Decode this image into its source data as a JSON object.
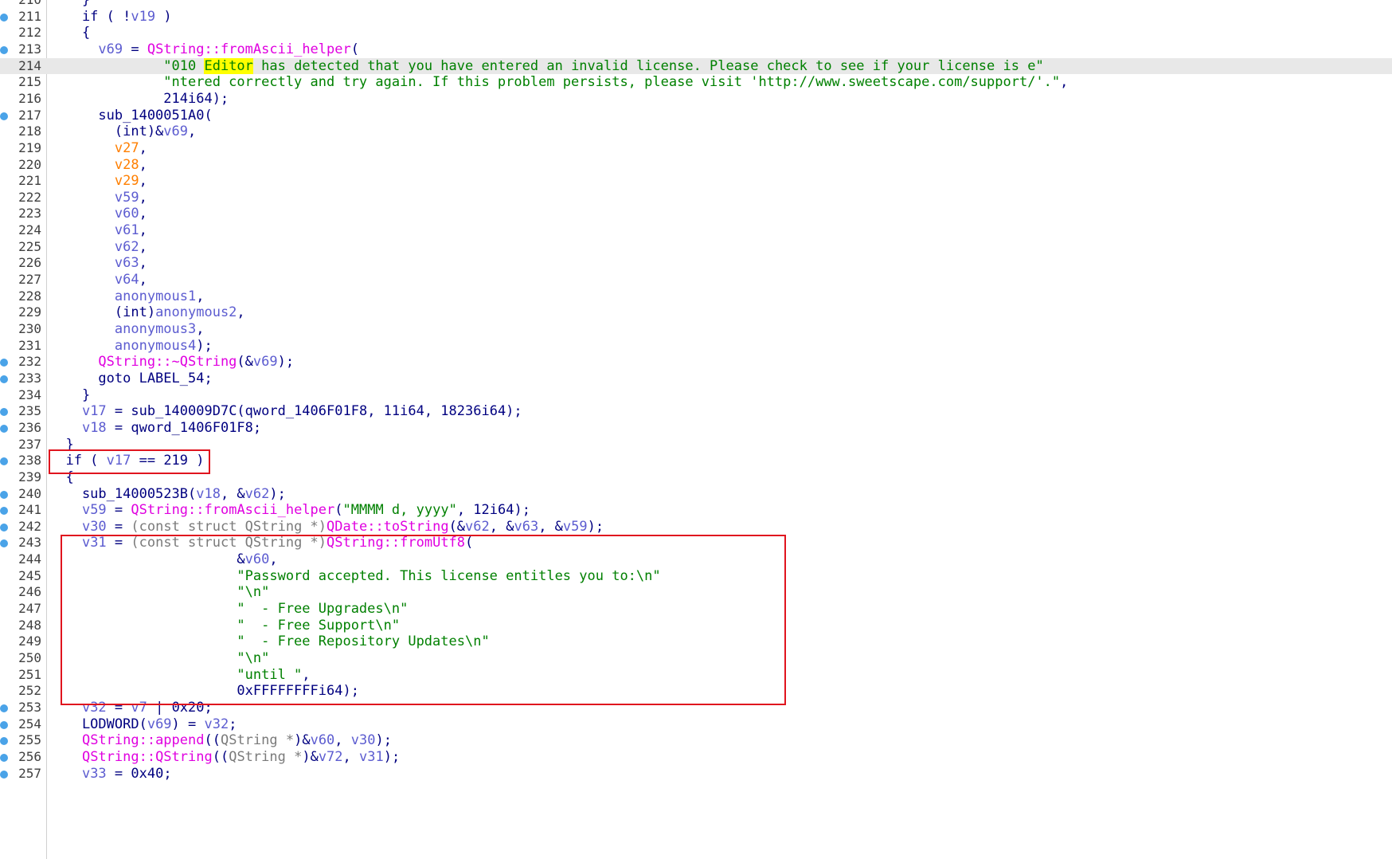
{
  "lines": [
    {
      "n": "210",
      "dot": false,
      "segs": [
        [
          "p",
          "    }"
        ]
      ]
    },
    {
      "n": "211",
      "dot": true,
      "segs": [
        [
          "p",
          "    if ( !"
        ],
        [
          "var",
          "v19"
        ],
        [
          "p",
          " )"
        ]
      ]
    },
    {
      "n": "212",
      "dot": false,
      "segs": [
        [
          "p",
          "    {"
        ]
      ]
    },
    {
      "n": "213",
      "dot": true,
      "segs": [
        [
          "p",
          "      "
        ],
        [
          "var",
          "v69"
        ],
        [
          "p",
          " = "
        ],
        [
          "fn",
          "QString::fromAscii_helper"
        ],
        [
          "p",
          "("
        ]
      ]
    },
    {
      "n": "214",
      "dot": false,
      "current": true,
      "segs": [
        [
          "p",
          "              "
        ],
        [
          "str",
          "\"010 "
        ],
        [
          "hl",
          "Editor"
        ],
        [
          "str",
          " has detected that you have entered an invalid license. Please check to see if your license is e\""
        ]
      ]
    },
    {
      "n": "215",
      "dot": false,
      "segs": [
        [
          "p",
          "              "
        ],
        [
          "str",
          "\"ntered correctly and try again. If this problem persists, please visit 'http://www.sweetscape.com/support/'.\""
        ],
        [
          "p",
          ","
        ]
      ]
    },
    {
      "n": "216",
      "dot": false,
      "segs": [
        [
          "p",
          "              214i64);"
        ]
      ]
    },
    {
      "n": "217",
      "dot": true,
      "segs": [
        [
          "p",
          "      sub_1400051A0("
        ]
      ]
    },
    {
      "n": "218",
      "dot": false,
      "segs": [
        [
          "p",
          "        (int)&"
        ],
        [
          "var",
          "v69"
        ],
        [
          "p",
          ","
        ]
      ]
    },
    {
      "n": "219",
      "dot": false,
      "segs": [
        [
          "p",
          "        "
        ],
        [
          "varo",
          "v27"
        ],
        [
          "p",
          ","
        ]
      ]
    },
    {
      "n": "220",
      "dot": false,
      "segs": [
        [
          "p",
          "        "
        ],
        [
          "varo",
          "v28"
        ],
        [
          "p",
          ","
        ]
      ]
    },
    {
      "n": "221",
      "dot": false,
      "segs": [
        [
          "p",
          "        "
        ],
        [
          "varo",
          "v29"
        ],
        [
          "p",
          ","
        ]
      ]
    },
    {
      "n": "222",
      "dot": false,
      "segs": [
        [
          "p",
          "        "
        ],
        [
          "var",
          "v59"
        ],
        [
          "p",
          ","
        ]
      ]
    },
    {
      "n": "223",
      "dot": false,
      "segs": [
        [
          "p",
          "        "
        ],
        [
          "var",
          "v60"
        ],
        [
          "p",
          ","
        ]
      ]
    },
    {
      "n": "224",
      "dot": false,
      "segs": [
        [
          "p",
          "        "
        ],
        [
          "var",
          "v61"
        ],
        [
          "p",
          ","
        ]
      ]
    },
    {
      "n": "225",
      "dot": false,
      "segs": [
        [
          "p",
          "        "
        ],
        [
          "var",
          "v62"
        ],
        [
          "p",
          ","
        ]
      ]
    },
    {
      "n": "226",
      "dot": false,
      "segs": [
        [
          "p",
          "        "
        ],
        [
          "var",
          "v63"
        ],
        [
          "p",
          ","
        ]
      ]
    },
    {
      "n": "227",
      "dot": false,
      "segs": [
        [
          "p",
          "        "
        ],
        [
          "var",
          "v64"
        ],
        [
          "p",
          ","
        ]
      ]
    },
    {
      "n": "228",
      "dot": false,
      "segs": [
        [
          "p",
          "        "
        ],
        [
          "var",
          "anonymous1"
        ],
        [
          "p",
          ","
        ]
      ]
    },
    {
      "n": "229",
      "dot": false,
      "segs": [
        [
          "p",
          "        (int)"
        ],
        [
          "var",
          "anonymous2"
        ],
        [
          "p",
          ","
        ]
      ]
    },
    {
      "n": "230",
      "dot": false,
      "segs": [
        [
          "p",
          "        "
        ],
        [
          "var",
          "anonymous3"
        ],
        [
          "p",
          ","
        ]
      ]
    },
    {
      "n": "231",
      "dot": false,
      "segs": [
        [
          "p",
          "        "
        ],
        [
          "var",
          "anonymous4"
        ],
        [
          "p",
          ");"
        ]
      ]
    },
    {
      "n": "232",
      "dot": true,
      "segs": [
        [
          "p",
          "      "
        ],
        [
          "fn",
          "QString::~QString"
        ],
        [
          "p",
          "(&"
        ],
        [
          "var",
          "v69"
        ],
        [
          "p",
          ");"
        ]
      ]
    },
    {
      "n": "233",
      "dot": true,
      "segs": [
        [
          "p",
          "      goto LABEL_54;"
        ]
      ]
    },
    {
      "n": "234",
      "dot": false,
      "segs": [
        [
          "p",
          "    }"
        ]
      ]
    },
    {
      "n": "235",
      "dot": true,
      "segs": [
        [
          "p",
          "    "
        ],
        [
          "var",
          "v17"
        ],
        [
          "p",
          " = sub_140009D7C(qword_1406F01F8, 11i64, 18236i64);"
        ]
      ]
    },
    {
      "n": "236",
      "dot": true,
      "segs": [
        [
          "p",
          "    "
        ],
        [
          "var",
          "v18"
        ],
        [
          "p",
          " = qword_1406F01F8;"
        ]
      ]
    },
    {
      "n": "237",
      "dot": false,
      "segs": [
        [
          "p",
          "  }"
        ]
      ]
    },
    {
      "n": "238",
      "dot": true,
      "segs": [
        [
          "p",
          "  if ( "
        ],
        [
          "var",
          "v17"
        ],
        [
          "p",
          " == 219 )"
        ]
      ]
    },
    {
      "n": "239",
      "dot": false,
      "segs": [
        [
          "p",
          "  {"
        ]
      ]
    },
    {
      "n": "240",
      "dot": true,
      "segs": [
        [
          "p",
          "    sub_14000523B("
        ],
        [
          "var",
          "v18"
        ],
        [
          "p",
          ", &"
        ],
        [
          "var",
          "v62"
        ],
        [
          "p",
          ");"
        ]
      ]
    },
    {
      "n": "241",
      "dot": true,
      "segs": [
        [
          "p",
          "    "
        ],
        [
          "var",
          "v59"
        ],
        [
          "p",
          " = "
        ],
        [
          "fn",
          "QString::fromAscii_helper"
        ],
        [
          "p",
          "("
        ],
        [
          "str",
          "\"MMMM d, yyyy\""
        ],
        [
          "p",
          ", 12i64);"
        ]
      ]
    },
    {
      "n": "242",
      "dot": true,
      "segs": [
        [
          "p",
          "    "
        ],
        [
          "var",
          "v30"
        ],
        [
          "p",
          " = "
        ],
        [
          "gray",
          "(const struct QString *)"
        ],
        [
          "fn",
          "QDate::toString"
        ],
        [
          "p",
          "(&"
        ],
        [
          "var",
          "v62"
        ],
        [
          "p",
          ", &"
        ],
        [
          "var",
          "v63"
        ],
        [
          "p",
          ", &"
        ],
        [
          "var",
          "v59"
        ],
        [
          "p",
          ");"
        ]
      ]
    },
    {
      "n": "243",
      "dot": true,
      "segs": [
        [
          "p",
          "    "
        ],
        [
          "var",
          "v31"
        ],
        [
          "p",
          " = "
        ],
        [
          "gray",
          "(const struct QString *)"
        ],
        [
          "fn",
          "QString::fromUtf8"
        ],
        [
          "p",
          "("
        ]
      ]
    },
    {
      "n": "244",
      "dot": false,
      "segs": [
        [
          "p",
          "                       &"
        ],
        [
          "var",
          "v60"
        ],
        [
          "p",
          ","
        ]
      ]
    },
    {
      "n": "245",
      "dot": false,
      "segs": [
        [
          "p",
          "                       "
        ],
        [
          "str",
          "\"Password accepted. This license entitles you to:\\n\""
        ]
      ]
    },
    {
      "n": "246",
      "dot": false,
      "segs": [
        [
          "p",
          "                       "
        ],
        [
          "str",
          "\"\\n\""
        ]
      ]
    },
    {
      "n": "247",
      "dot": false,
      "segs": [
        [
          "p",
          "                       "
        ],
        [
          "str",
          "\"  - Free Upgrades\\n\""
        ]
      ]
    },
    {
      "n": "248",
      "dot": false,
      "segs": [
        [
          "p",
          "                       "
        ],
        [
          "str",
          "\"  - Free Support\\n\""
        ]
      ]
    },
    {
      "n": "249",
      "dot": false,
      "segs": [
        [
          "p",
          "                       "
        ],
        [
          "str",
          "\"  - Free Repository Updates\\n\""
        ]
      ]
    },
    {
      "n": "250",
      "dot": false,
      "segs": [
        [
          "p",
          "                       "
        ],
        [
          "str",
          "\"\\n\""
        ]
      ]
    },
    {
      "n": "251",
      "dot": false,
      "segs": [
        [
          "p",
          "                       "
        ],
        [
          "str",
          "\"until \""
        ],
        [
          "p",
          ","
        ]
      ]
    },
    {
      "n": "252",
      "dot": false,
      "segs": [
        [
          "p",
          "                       0xFFFFFFFFi64);"
        ]
      ]
    },
    {
      "n": "253",
      "dot": true,
      "segs": [
        [
          "p",
          "    "
        ],
        [
          "var",
          "v32"
        ],
        [
          "p",
          " = "
        ],
        [
          "var",
          "v7"
        ],
        [
          "p",
          " | 0x20;"
        ]
      ]
    },
    {
      "n": "254",
      "dot": true,
      "segs": [
        [
          "p",
          "    LODWORD("
        ],
        [
          "var",
          "v69"
        ],
        [
          "p",
          ") = "
        ],
        [
          "var",
          "v32"
        ],
        [
          "p",
          ";"
        ]
      ]
    },
    {
      "n": "255",
      "dot": true,
      "segs": [
        [
          "p",
          "    "
        ],
        [
          "fn",
          "QString::append"
        ],
        [
          "p",
          "(("
        ],
        [
          "gray",
          "QString *"
        ],
        [
          "p",
          ")&"
        ],
        [
          "var",
          "v60"
        ],
        [
          "p",
          ", "
        ],
        [
          "var",
          "v30"
        ],
        [
          "p",
          ");"
        ]
      ]
    },
    {
      "n": "256",
      "dot": true,
      "segs": [
        [
          "p",
          "    "
        ],
        [
          "fn",
          "QString::QString"
        ],
        [
          "p",
          "(("
        ],
        [
          "gray",
          "QString *"
        ],
        [
          "p",
          ")&"
        ],
        [
          "var",
          "v72"
        ],
        [
          "p",
          ", "
        ],
        [
          "var",
          "v31"
        ],
        [
          "p",
          ");"
        ]
      ]
    },
    {
      "n": "257",
      "dot": true,
      "segs": [
        [
          "p",
          "    "
        ],
        [
          "var",
          "v33"
        ],
        [
          "p",
          " = 0x40;"
        ]
      ]
    }
  ],
  "colors": {
    "accent_box": "#e0141e",
    "breakpoint_dot": "#4aa3e8",
    "highlight": "#ffff00"
  }
}
